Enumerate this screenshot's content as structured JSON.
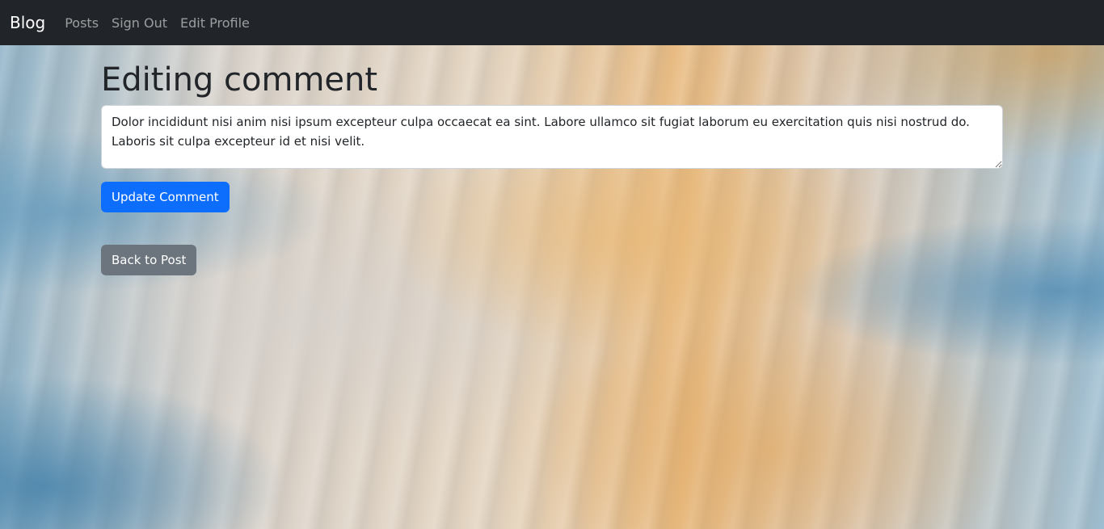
{
  "navbar": {
    "brand": "Blog",
    "links": [
      {
        "label": "Posts"
      },
      {
        "label": "Sign Out"
      },
      {
        "label": "Edit Profile"
      }
    ]
  },
  "page": {
    "title": "Editing comment"
  },
  "form": {
    "comment_value": "Dolor incididunt nisi anim nisi ipsum excepteur culpa occaecat ea sint. Labore ullamco sit fugiat laborum eu exercitation quis nisi nostrud do. Laboris sit culpa excepteur id et nisi velit.",
    "submit_label": "Update Comment"
  },
  "back": {
    "label": "Back to Post"
  },
  "colors": {
    "navbar_bg": "#212529",
    "primary": "#0d6efd",
    "secondary": "#6c757d"
  }
}
